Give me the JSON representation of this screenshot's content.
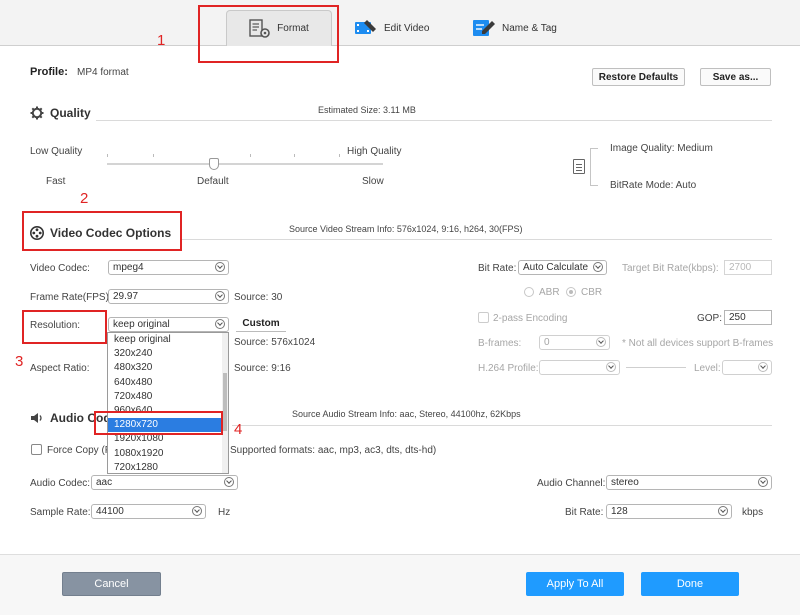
{
  "tabs": [
    {
      "label": "Format",
      "icon": "format-settings-icon",
      "active": true
    },
    {
      "label": "Edit Video",
      "icon": "video-edit-icon"
    },
    {
      "label": "Name & Tag",
      "icon": "pencil-tag-icon"
    }
  ],
  "annotations": {
    "step1": "1",
    "step2": "2",
    "step3": "3",
    "step4": "4",
    "color": "#e02424"
  },
  "profile": {
    "label": "Profile:",
    "value": "MP4 format"
  },
  "buttons": {
    "restore": "Restore Defaults",
    "save_as": "Save as...",
    "cancel": "Cancel",
    "apply_all": "Apply To All",
    "done": "Done"
  },
  "quality": {
    "title": "Quality",
    "estimated_size": "Estimated Size: 3.11 MB",
    "low": "Low Quality",
    "high": "High Quality",
    "fast": "Fast",
    "default": "Default",
    "slow": "Slow",
    "image_quality": "Image Quality: Medium",
    "bitrate_mode": "BitRate Mode: Auto"
  },
  "video": {
    "title": "Video Codec Options",
    "source_info": "Source Video Stream Info: 576x1024, 9:16, h264, 30(FPS)",
    "codec_label": "Video Codec:",
    "codec_value": "mpeg4",
    "framerate_label": "Frame Rate(FPS):",
    "framerate_value": "29.97",
    "framerate_source": "Source: 30",
    "resolution_label": "Resolution:",
    "resolution_value": "keep original",
    "custom_label": "Custom",
    "resolution_source": "Source: 576x1024",
    "aspect_label": "Aspect Ratio:",
    "aspect_source": "Source: 9:16",
    "bitrate_label": "Bit Rate:",
    "bitrate_value": "Auto Calculate",
    "target_bitrate_label": "Target Bit Rate(kbps):",
    "target_bitrate_value": "2700",
    "abr": "ABR",
    "cbr": "CBR",
    "twopass": "2-pass Encoding",
    "gop_label": "GOP:",
    "gop_value": "250",
    "bframes_label": "B-frames:",
    "bframes_value": "0",
    "bframes_note": "* Not all devices support B-frames",
    "h264_profile_label": "H.264 Profile:",
    "level_label": "Level:",
    "resolution_options": [
      "keep original",
      "320x240",
      "480x320",
      "640x480",
      "720x480",
      "960x640",
      "1280x720",
      "1920x1080",
      "1080x1920",
      "720x1280"
    ],
    "selected_index": 6
  },
  "audio": {
    "title": "Audio Codec",
    "source_info": "Source Audio Stream Info: aac, Stereo, 44100hz, 62Kbps",
    "force_copy": "Force Copy (P",
    "supported": "Supported formats: aac, mp3, ac3, dts, dts-hd)",
    "codec_label": "Audio Codec:",
    "codec_value": "aac",
    "channel_label": "Audio Channel:",
    "channel_value": "stereo",
    "samplerate_label": "Sample Rate:",
    "samplerate_value": "44100",
    "hz": "Hz",
    "bitrate_label": "Bit Rate:",
    "bitrate_value": "128",
    "kbps": "kbps"
  },
  "colors": {
    "accent": "#1f9bff",
    "cancel": "#8793a2",
    "selection": "#2b7de1"
  }
}
